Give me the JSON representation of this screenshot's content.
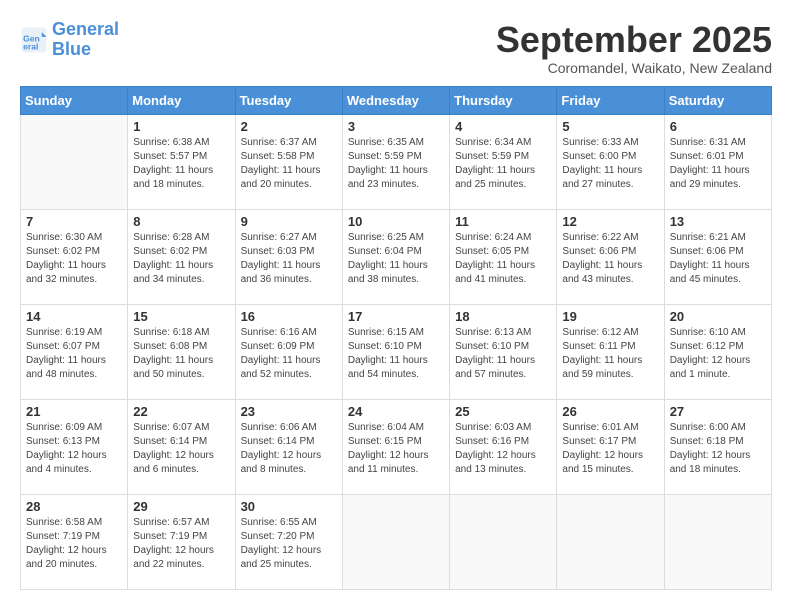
{
  "logo": {
    "line1": "General",
    "line2": "Blue"
  },
  "title": "September 2025",
  "location": "Coromandel, Waikato, New Zealand",
  "days": [
    "Sunday",
    "Monday",
    "Tuesday",
    "Wednesday",
    "Thursday",
    "Friday",
    "Saturday"
  ],
  "weeks": [
    [
      {
        "day": "",
        "sunrise": "",
        "sunset": "",
        "daylight": ""
      },
      {
        "day": "1",
        "sunrise": "Sunrise: 6:38 AM",
        "sunset": "Sunset: 5:57 PM",
        "daylight": "Daylight: 11 hours and 18 minutes."
      },
      {
        "day": "2",
        "sunrise": "Sunrise: 6:37 AM",
        "sunset": "Sunset: 5:58 PM",
        "daylight": "Daylight: 11 hours and 20 minutes."
      },
      {
        "day": "3",
        "sunrise": "Sunrise: 6:35 AM",
        "sunset": "Sunset: 5:59 PM",
        "daylight": "Daylight: 11 hours and 23 minutes."
      },
      {
        "day": "4",
        "sunrise": "Sunrise: 6:34 AM",
        "sunset": "Sunset: 5:59 PM",
        "daylight": "Daylight: 11 hours and 25 minutes."
      },
      {
        "day": "5",
        "sunrise": "Sunrise: 6:33 AM",
        "sunset": "Sunset: 6:00 PM",
        "daylight": "Daylight: 11 hours and 27 minutes."
      },
      {
        "day": "6",
        "sunrise": "Sunrise: 6:31 AM",
        "sunset": "Sunset: 6:01 PM",
        "daylight": "Daylight: 11 hours and 29 minutes."
      }
    ],
    [
      {
        "day": "7",
        "sunrise": "Sunrise: 6:30 AM",
        "sunset": "Sunset: 6:02 PM",
        "daylight": "Daylight: 11 hours and 32 minutes."
      },
      {
        "day": "8",
        "sunrise": "Sunrise: 6:28 AM",
        "sunset": "Sunset: 6:02 PM",
        "daylight": "Daylight: 11 hours and 34 minutes."
      },
      {
        "day": "9",
        "sunrise": "Sunrise: 6:27 AM",
        "sunset": "Sunset: 6:03 PM",
        "daylight": "Daylight: 11 hours and 36 minutes."
      },
      {
        "day": "10",
        "sunrise": "Sunrise: 6:25 AM",
        "sunset": "Sunset: 6:04 PM",
        "daylight": "Daylight: 11 hours and 38 minutes."
      },
      {
        "day": "11",
        "sunrise": "Sunrise: 6:24 AM",
        "sunset": "Sunset: 6:05 PM",
        "daylight": "Daylight: 11 hours and 41 minutes."
      },
      {
        "day": "12",
        "sunrise": "Sunrise: 6:22 AM",
        "sunset": "Sunset: 6:06 PM",
        "daylight": "Daylight: 11 hours and 43 minutes."
      },
      {
        "day": "13",
        "sunrise": "Sunrise: 6:21 AM",
        "sunset": "Sunset: 6:06 PM",
        "daylight": "Daylight: 11 hours and 45 minutes."
      }
    ],
    [
      {
        "day": "14",
        "sunrise": "Sunrise: 6:19 AM",
        "sunset": "Sunset: 6:07 PM",
        "daylight": "Daylight: 11 hours and 48 minutes."
      },
      {
        "day": "15",
        "sunrise": "Sunrise: 6:18 AM",
        "sunset": "Sunset: 6:08 PM",
        "daylight": "Daylight: 11 hours and 50 minutes."
      },
      {
        "day": "16",
        "sunrise": "Sunrise: 6:16 AM",
        "sunset": "Sunset: 6:09 PM",
        "daylight": "Daylight: 11 hours and 52 minutes."
      },
      {
        "day": "17",
        "sunrise": "Sunrise: 6:15 AM",
        "sunset": "Sunset: 6:10 PM",
        "daylight": "Daylight: 11 hours and 54 minutes."
      },
      {
        "day": "18",
        "sunrise": "Sunrise: 6:13 AM",
        "sunset": "Sunset: 6:10 PM",
        "daylight": "Daylight: 11 hours and 57 minutes."
      },
      {
        "day": "19",
        "sunrise": "Sunrise: 6:12 AM",
        "sunset": "Sunset: 6:11 PM",
        "daylight": "Daylight: 11 hours and 59 minutes."
      },
      {
        "day": "20",
        "sunrise": "Sunrise: 6:10 AM",
        "sunset": "Sunset: 6:12 PM",
        "daylight": "Daylight: 12 hours and 1 minute."
      }
    ],
    [
      {
        "day": "21",
        "sunrise": "Sunrise: 6:09 AM",
        "sunset": "Sunset: 6:13 PM",
        "daylight": "Daylight: 12 hours and 4 minutes."
      },
      {
        "day": "22",
        "sunrise": "Sunrise: 6:07 AM",
        "sunset": "Sunset: 6:14 PM",
        "daylight": "Daylight: 12 hours and 6 minutes."
      },
      {
        "day": "23",
        "sunrise": "Sunrise: 6:06 AM",
        "sunset": "Sunset: 6:14 PM",
        "daylight": "Daylight: 12 hours and 8 minutes."
      },
      {
        "day": "24",
        "sunrise": "Sunrise: 6:04 AM",
        "sunset": "Sunset: 6:15 PM",
        "daylight": "Daylight: 12 hours and 11 minutes."
      },
      {
        "day": "25",
        "sunrise": "Sunrise: 6:03 AM",
        "sunset": "Sunset: 6:16 PM",
        "daylight": "Daylight: 12 hours and 13 minutes."
      },
      {
        "day": "26",
        "sunrise": "Sunrise: 6:01 AM",
        "sunset": "Sunset: 6:17 PM",
        "daylight": "Daylight: 12 hours and 15 minutes."
      },
      {
        "day": "27",
        "sunrise": "Sunrise: 6:00 AM",
        "sunset": "Sunset: 6:18 PM",
        "daylight": "Daylight: 12 hours and 18 minutes."
      }
    ],
    [
      {
        "day": "28",
        "sunrise": "Sunrise: 6:58 AM",
        "sunset": "Sunset: 7:19 PM",
        "daylight": "Daylight: 12 hours and 20 minutes."
      },
      {
        "day": "29",
        "sunrise": "Sunrise: 6:57 AM",
        "sunset": "Sunset: 7:19 PM",
        "daylight": "Daylight: 12 hours and 22 minutes."
      },
      {
        "day": "30",
        "sunrise": "Sunrise: 6:55 AM",
        "sunset": "Sunset: 7:20 PM",
        "daylight": "Daylight: 12 hours and 25 minutes."
      },
      {
        "day": "",
        "sunrise": "",
        "sunset": "",
        "daylight": ""
      },
      {
        "day": "",
        "sunrise": "",
        "sunset": "",
        "daylight": ""
      },
      {
        "day": "",
        "sunrise": "",
        "sunset": "",
        "daylight": ""
      },
      {
        "day": "",
        "sunrise": "",
        "sunset": "",
        "daylight": ""
      }
    ]
  ]
}
